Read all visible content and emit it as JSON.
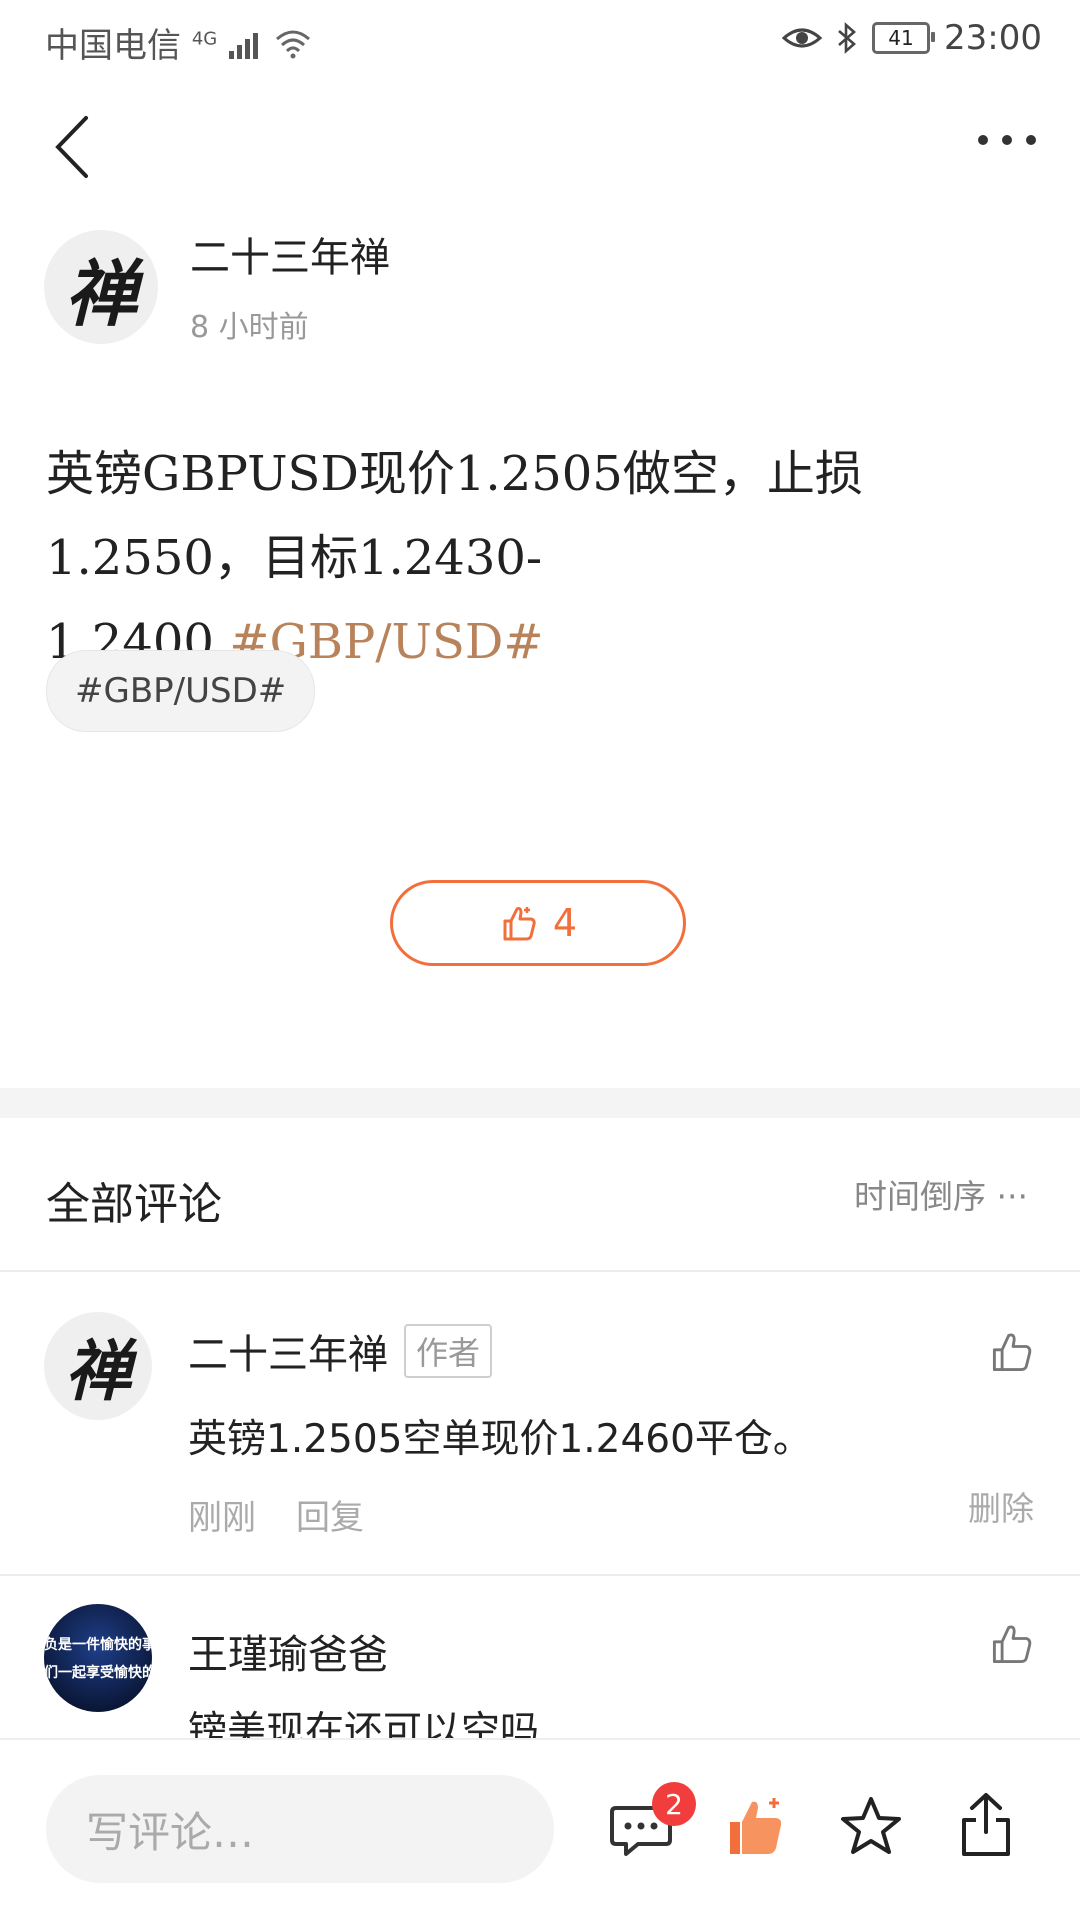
{
  "status_bar": {
    "carrier": "中国电信",
    "network": "4G",
    "battery": "41",
    "time": "23:00"
  },
  "post": {
    "author": "二十三年禅",
    "avatar_char": "禅",
    "time": "8 小时前",
    "text": "英镑GBPUSD现价1.2505做空，止损1.2550，目标1.2430-1.2400.",
    "inline_tag": "#GBP/USD#",
    "chip_tag": "#GBP/USD#",
    "like_count": "4"
  },
  "comments_section": {
    "title": "全部评论",
    "sort_label": "时间倒序"
  },
  "comments": [
    {
      "author": "二十三年禅",
      "badge": "作者",
      "text": "英镑1.2505空单现价1.2460平仓。",
      "time": "刚刚",
      "reply": "回复",
      "delete": "删除",
      "avatar_char": "禅"
    },
    {
      "author": "王瑾瑜爸爸",
      "text": "镑美现在还可以空吗",
      "avatar_banner_top": "负是一件愉快的事",
      "avatar_banner_bottom": "们一起享受愉快的"
    }
  ],
  "bottom_bar": {
    "placeholder": "写评论…",
    "comment_badge": "2"
  },
  "colors": {
    "accent": "#f26f3c",
    "tag": "#b8835a",
    "badge_red": "#f23d3d"
  }
}
